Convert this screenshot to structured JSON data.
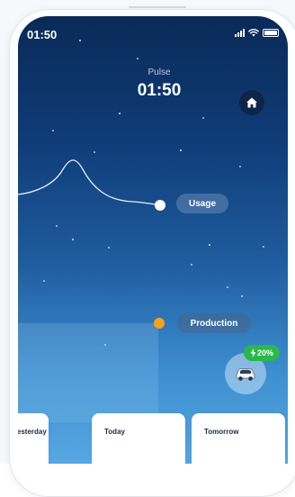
{
  "status_bar": {
    "time": "01:50"
  },
  "header": {
    "label": "Pulse",
    "time": "01:50"
  },
  "graph": {
    "usage_label": "Usage",
    "production_label": "Production"
  },
  "car": {
    "charge": "20%"
  },
  "days": [
    {
      "label": "Yesterday"
    },
    {
      "label": "Today"
    },
    {
      "label": "Tomorrow"
    }
  ],
  "colors": {
    "sky_top": "#0a2a57",
    "sky_bottom": "#57a7e2",
    "usage_dot": "#ffffff",
    "production_dot": "#f4a21a",
    "charge_badge": "#2ab84d"
  },
  "icons": {
    "home": "home-icon",
    "car": "car-icon",
    "bolt": "bolt-icon"
  }
}
